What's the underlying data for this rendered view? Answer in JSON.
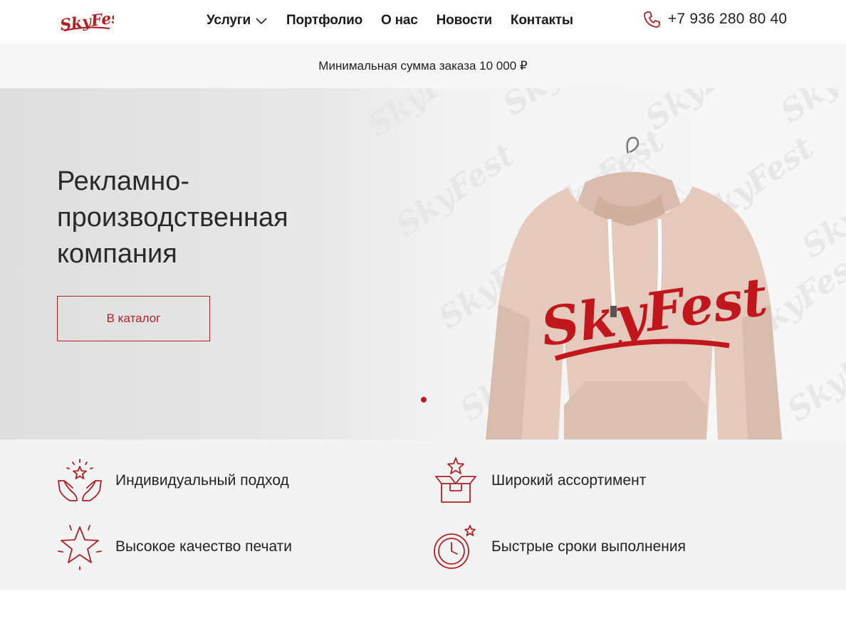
{
  "brand": {
    "logo_text": "SkyFest",
    "accent_color": "#b31f23"
  },
  "header": {
    "nav": [
      {
        "label": "Услуги",
        "has_dropdown": true
      },
      {
        "label": "Портфолио"
      },
      {
        "label": "О нас"
      },
      {
        "label": "Новости"
      },
      {
        "label": "Контакты"
      }
    ],
    "phone_icon": "phone-icon",
    "phone": "+7 936 280 80 40"
  },
  "notice": {
    "text": "Минимальная сумма заказа 10 000 ₽"
  },
  "hero": {
    "title": "Рекламно-производственная компания",
    "button_label": "В каталог",
    "hoodie_print": "SkyFest",
    "slider": {
      "active_index": 1,
      "count": 1
    }
  },
  "features": [
    {
      "icon": "hands-star-icon",
      "label": "Индивидуальный подход"
    },
    {
      "icon": "box-star-icon",
      "label": "Широкий ассортимент"
    },
    {
      "icon": "star-icon",
      "label": "Высокое качество печати"
    },
    {
      "icon": "clock-star-icon",
      "label": "Быстрые сроки выполнения"
    }
  ]
}
